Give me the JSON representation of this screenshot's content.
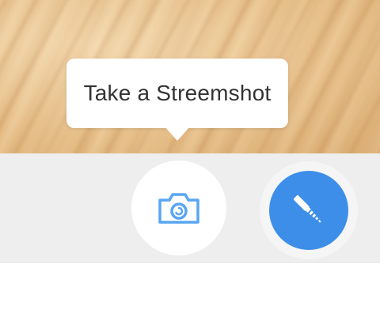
{
  "tooltip": {
    "text": "Take a Streemshot"
  },
  "toolbar": {
    "camera_button_icon": "camera-icon",
    "annotate_button_icon": "pen-icon"
  },
  "colors": {
    "accent": "#3d8ee8",
    "camera_icon": "#5aa6f2",
    "toolbar_bg": "#eeeeee"
  }
}
